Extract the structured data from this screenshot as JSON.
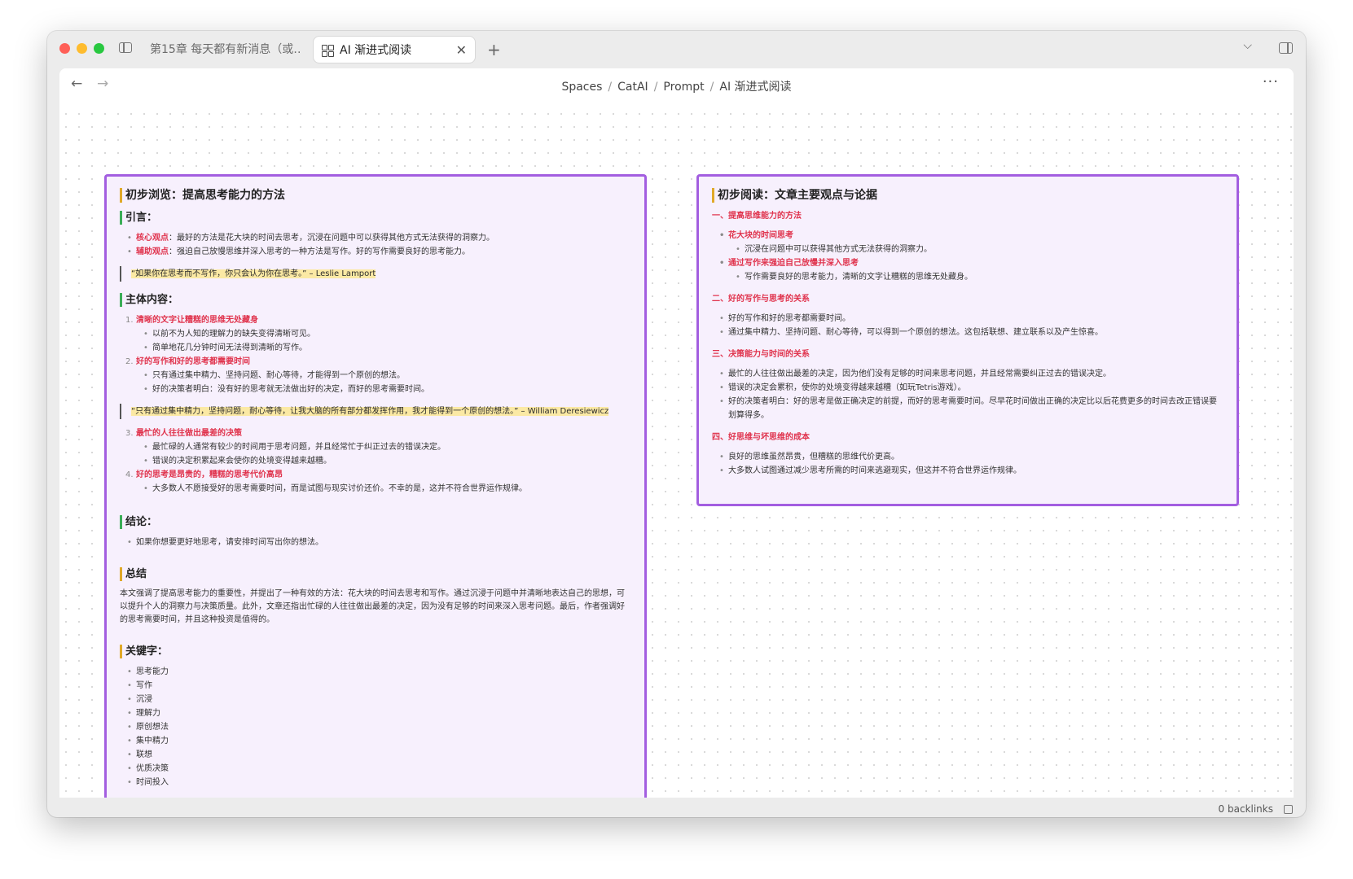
{
  "window": {
    "tabs": [
      {
        "label": "第15章 每天都有新消息（或…"
      },
      {
        "label": "AI 渐进式阅读"
      }
    ]
  },
  "breadcrumb": [
    "Spaces",
    "CatAI",
    "Prompt",
    "AI 渐进式阅读"
  ],
  "footer": {
    "backlinks": "0 backlinks"
  },
  "left_card": {
    "title": "初步浏览：提高思考能力的方法",
    "intro_heading": "引言：",
    "intro": [
      {
        "label": "核心观点",
        "text": "：最好的方法是花大块的时间去思考，沉浸在问题中可以获得其他方式无法获得的洞察力。"
      },
      {
        "label": "辅助观点",
        "text": "：强迫自己放慢思维并深入思考的一种方法是写作。好的写作需要良好的思考能力。"
      }
    ],
    "quote1": "“如果你在思考而不写作，你只会认为你在思考。” – Leslie Lamport",
    "body_heading": "主体内容：",
    "body_items": [
      {
        "num": "1.",
        "title": "清晰的文字让糟糕的思维无处藏身",
        "subs": [
          "以前不为人知的理解力的缺失变得清晰可见。",
          "简单地花几分钟时间无法得到清晰的写作。"
        ]
      },
      {
        "num": "2.",
        "title": "好的写作和好的思考都需要时间",
        "subs": [
          "只有通过集中精力、坚持问题、耐心等待，才能得到一个原创的想法。",
          "好的决策者明白：没有好的思考就无法做出好的决定，而好的思考需要时间。"
        ]
      }
    ],
    "quote2": "“只有通过集中精力，坚持问题，耐心等待，让我大脑的所有部分都发挥作用，我才能得到一个原创的想法。” – William Deresiewicz",
    "body_items2": [
      {
        "num": "3.",
        "title": "最忙的人往往做出最差的决策",
        "subs": [
          "最忙碌的人通常有较少的时间用于思考问题，并且经常忙于纠正过去的错误决定。",
          "错误的决定积累起来会使你的处境变得越来越糟。"
        ]
      },
      {
        "num": "4.",
        "title": "好的思考是昂贵的，糟糕的思考代价高昂",
        "subs": [
          "大多数人不愿接受好的思考需要时间，而是试图与现实讨价还价。不幸的是，这并不符合世界运作规律。"
        ]
      }
    ],
    "conclusion_heading": "结论：",
    "conclusion": [
      "如果你想要更好地思考，请安排时间写出你的想法。"
    ],
    "summary_heading": "总结",
    "summary": "本文强调了提高思考能力的重要性，并提出了一种有效的方法：花大块的时间去思考和写作。通过沉浸于问题中并清晰地表达自己的思想，可以提升个人的洞察力与决策质量。此外，文章还指出忙碌的人往往做出最差的决定，因为没有足够的时间来深入思考问题。最后，作者强调好的思考需要时间，并且这种投资是值得的。",
    "keywords_heading": "关键字：",
    "keywords": [
      "思考能力",
      "写作",
      "沉浸",
      "理解力",
      "原创想法",
      "集中精力",
      "联想",
      "优质决策",
      "时间投入"
    ]
  },
  "right_card": {
    "title": "初步阅读：文章主要观点与论据",
    "sections": [
      {
        "title": "一、提高思维能力的方法",
        "items": [
          {
            "text": "花大块的时间思考",
            "red": true,
            "subs": [
              "沉浸在问题中可以获得其他方式无法获得的洞察力。"
            ]
          },
          {
            "text": "通过写作来强迫自己放慢并深入思考",
            "red": true,
            "subs": [
              "写作需要良好的思考能力，清晰的文字让糟糕的思维无处藏身。"
            ]
          }
        ]
      },
      {
        "title": "二、好的写作与思考的关系",
        "items": [
          {
            "text": "好的写作和好的思考都需要时间。",
            "red": false,
            "subs": []
          },
          {
            "text": "通过集中精力、坚持问题、耐心等待，可以得到一个原创的想法。这包括联想、建立联系以及产生惊喜。",
            "red": false,
            "subs": []
          }
        ]
      },
      {
        "title": "三、决策能力与时间的关系",
        "items": [
          {
            "text": "最忙的人往往做出最差的决定，因为他们没有足够的时间来思考问题，并且经常需要纠正过去的错误决定。",
            "red": false,
            "subs": []
          },
          {
            "text": "错误的决定会累积，使你的处境变得越来越糟（如玩Tetris游戏）。",
            "red": false,
            "subs": []
          },
          {
            "text": "好的决策者明白：好的思考是做正确决定的前提，而好的思考需要时间。尽早花时间做出正确的决定比以后花费更多的时间去改正错误要划算得多。",
            "red": false,
            "subs": []
          }
        ]
      },
      {
        "title": "四、好思维与坏思维的成本",
        "items": [
          {
            "text": "良好的思维虽然昂贵，但糟糕的思维代价更高。",
            "red": false,
            "subs": []
          },
          {
            "text": "大多数人试图通过减少思考所需的时间来逃避现实，但这并不符合世界运作规律。",
            "red": false,
            "subs": []
          }
        ]
      }
    ]
  },
  "colors": {
    "accent_purple": "#a35ee0",
    "heading_red": "#e0334d",
    "card_bg": "#f7f0fd",
    "highlight": "#fbe9a4"
  }
}
